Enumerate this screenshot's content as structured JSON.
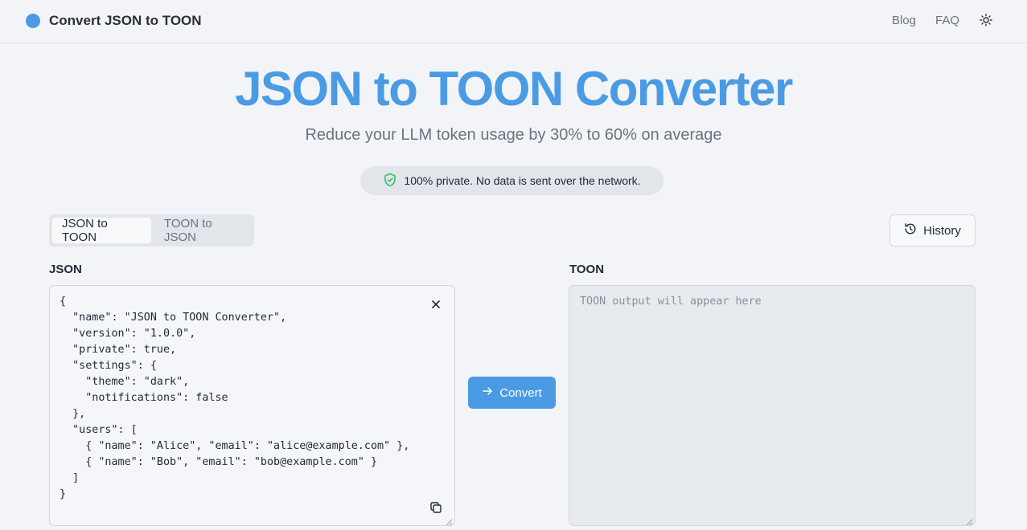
{
  "header": {
    "brand": "Convert JSON to TOON",
    "nav": {
      "blog": "Blog",
      "faq": "FAQ"
    },
    "theme_icon": "sun-icon"
  },
  "hero": {
    "title": "JSON to TOON Converter",
    "subtitle": "Reduce your LLM token usage by 30% to 60% on average",
    "privacy_badge": "100% private. No data is sent over the network."
  },
  "mode_tabs": {
    "active": "JSON to TOON",
    "inactive": "TOON to JSON"
  },
  "history_label": "History",
  "json_panel": {
    "label": "JSON",
    "value": "{\n  \"name\": \"JSON to TOON Converter\",\n  \"version\": \"1.0.0\",\n  \"private\": true,\n  \"settings\": {\n    \"theme\": \"dark\",\n    \"notifications\": false\n  },\n  \"users\": [\n    { \"name\": \"Alice\", \"email\": \"alice@example.com\" },\n    { \"name\": \"Bob\", \"email\": \"bob@example.com\" }\n  ]\n}"
  },
  "convert_label": "Convert",
  "toon_panel": {
    "label": "TOON",
    "placeholder": "TOON output will appear here"
  },
  "colors": {
    "accent": "#4a9be3",
    "background": "#f3f4f8",
    "shield": "#22c55e"
  }
}
